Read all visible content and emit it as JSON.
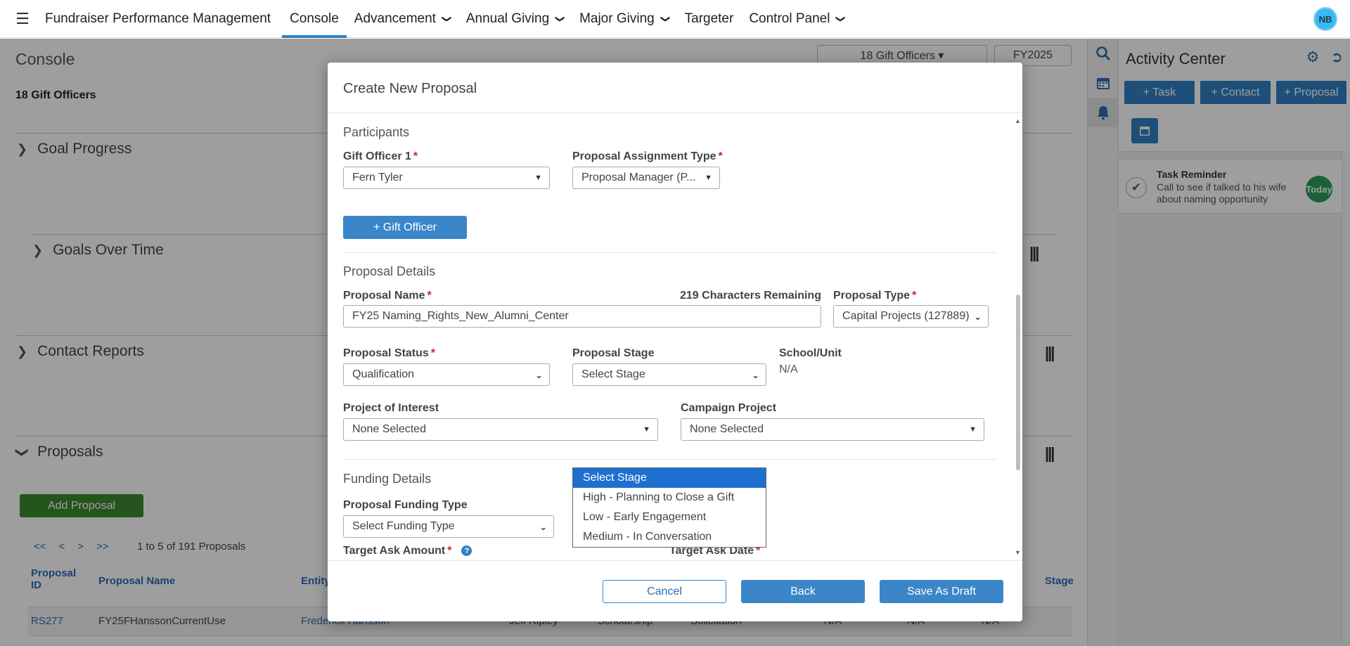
{
  "topnav": {
    "brand": "Fundraiser Performance Management",
    "items": [
      {
        "label": "Console",
        "has_menu": false,
        "active": true
      },
      {
        "label": "Advancement",
        "has_menu": true
      },
      {
        "label": "Annual Giving",
        "has_menu": true
      },
      {
        "label": "Major Giving",
        "has_menu": true
      },
      {
        "label": "Targeter",
        "has_menu": false
      },
      {
        "label": "Control Panel",
        "has_menu": true
      }
    ],
    "user_initials": "NB"
  },
  "console": {
    "title": "Console",
    "officers_filter": "18 Gift Officers ▾",
    "fiscal_year": "FY2025",
    "officers_count": "18 Gift Officers",
    "sections": {
      "goal_progress": "Goal Progress",
      "goals_over_time": "Goals Over Time",
      "contact_reports": "Contact Reports",
      "proposals": "Proposals"
    },
    "add_proposal": "Add Proposal",
    "pager": [
      "<<",
      "<",
      ">",
      ">>"
    ],
    "pager_info": "1 to 5 of 191 Proposals",
    "table_headers": {
      "proposal_id": "Proposal ID",
      "proposal_name": "Proposal Name",
      "entity": "Entity",
      "stage": "Stage"
    },
    "first_row": {
      "id": "RS277",
      "name": "FY25FHanssonCurrentUse",
      "entity": "Frederick Hansson",
      "officer": "Jeff Ripley",
      "type": "Scholarship",
      "status": "Solicitation",
      "col1": "N/A",
      "col2": "N/A",
      "col3": "N/A"
    }
  },
  "activity_center": {
    "title": "Activity Center",
    "buttons": {
      "task": "+ Task",
      "contact": "+ Contact",
      "proposal": "+ Proposal"
    },
    "task": {
      "title": "Task Reminder",
      "description": "Call to see if talked to his wife about naming opportunity",
      "badge": "Today"
    }
  },
  "modal": {
    "title": "Create New Proposal",
    "participants": {
      "heading": "Participants",
      "gift_officer_label": "Gift Officer 1",
      "gift_officer_value": "Fern Tyler",
      "assignment_type_label": "Proposal Assignment Type",
      "assignment_type_value": "Proposal Manager (P...",
      "add_officer": "+ Gift Officer"
    },
    "details": {
      "heading": "Proposal Details",
      "name_label": "Proposal Name",
      "chars_remaining": "219 Characters Remaining",
      "name_value": "FY25 Naming_Rights_New_Alumni_Center",
      "type_label": "Proposal Type",
      "type_value": "Capital Projects (127889)",
      "status_label": "Proposal Status",
      "status_value": "Qualification",
      "stage_label": "Proposal Stage",
      "stage_value": "Select Stage",
      "school_label": "School/Unit",
      "school_value": "N/A",
      "project_label": "Project of Interest",
      "project_value": "None Selected",
      "campaign_label": "Campaign Project",
      "campaign_value": "None Selected"
    },
    "funding": {
      "heading": "Funding Details",
      "funding_type_label": "Proposal Funding Type",
      "funding_type_value": "Select Funding Type",
      "ask_amount_label": "Target Ask Amount",
      "ask_date_label": "Target Ask Date"
    },
    "stage_options": [
      "Select Stage",
      "High - Planning to Close a Gift",
      "Low - Early Engagement",
      "Medium - In Conversation"
    ],
    "footer": {
      "cancel": "Cancel",
      "back": "Back",
      "save": "Save As Draft"
    }
  }
}
